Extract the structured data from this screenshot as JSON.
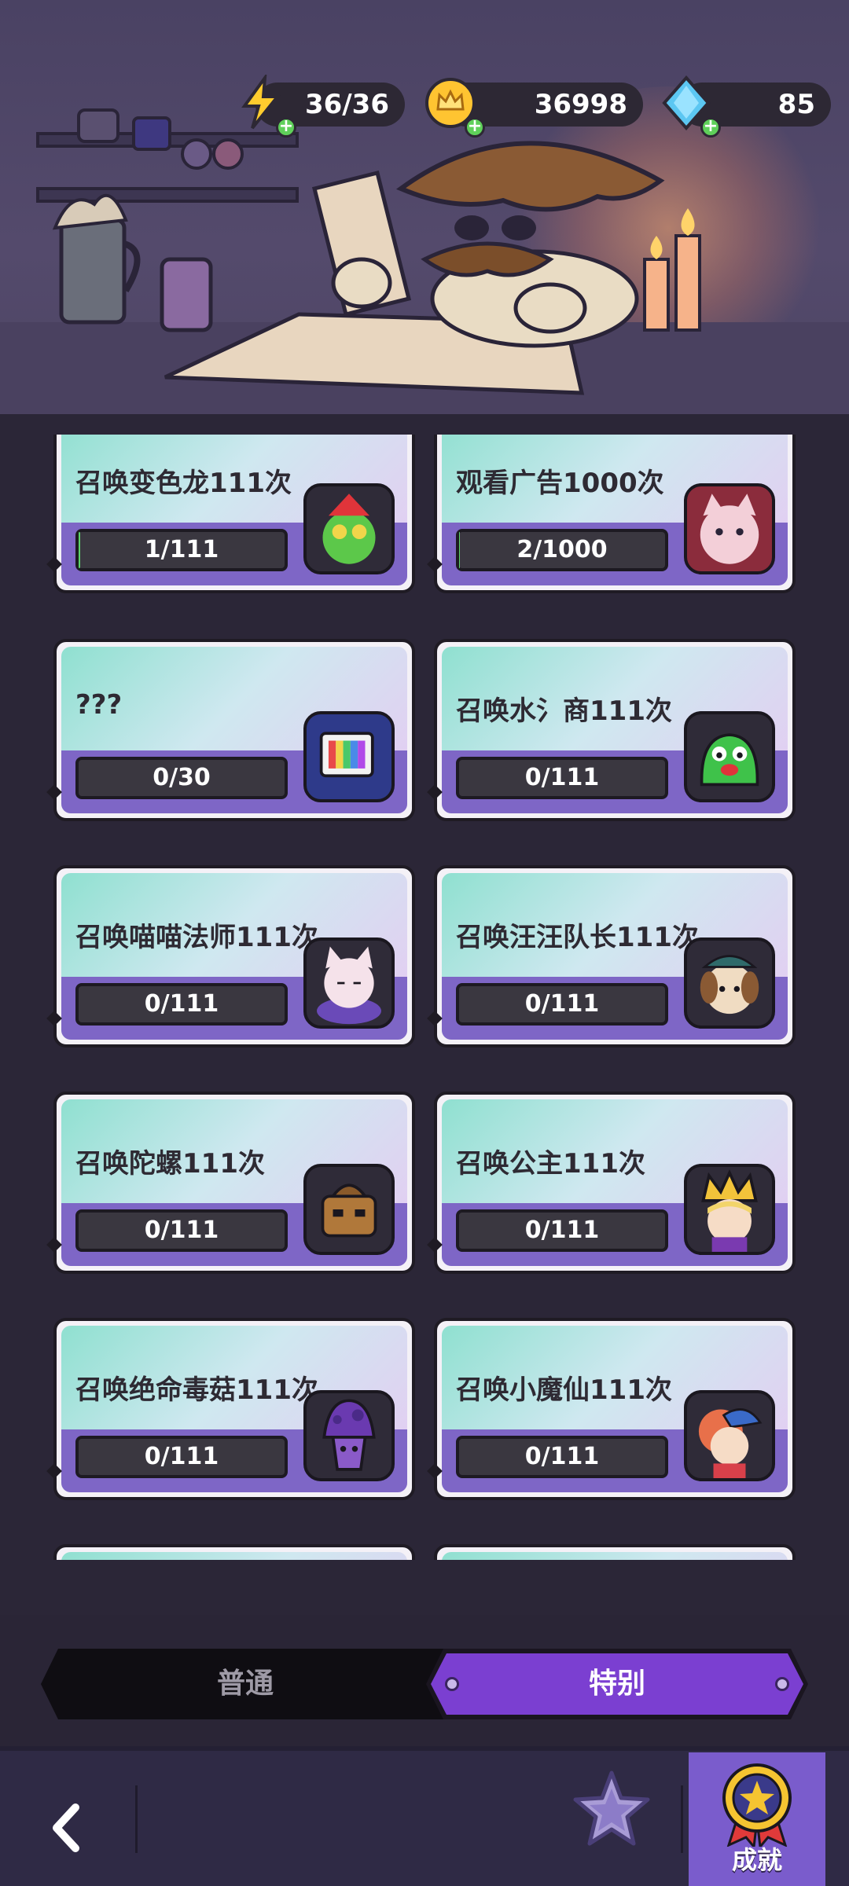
{
  "resources": {
    "energy": "36/36",
    "gold": "36998",
    "gems": "85"
  },
  "cards": [
    {
      "title": "召唤变色龙111次",
      "progress": "1/111",
      "fraction": 0.009,
      "portrait": "chameleon-portrait-icon"
    },
    {
      "title": "观看广告1000次",
      "progress": "2/1000",
      "fraction": 0.002,
      "portrait": "cat-portrait-icon"
    },
    {
      "title": "???",
      "progress": "0/30",
      "fraction": 0,
      "portrait": "tv-portrait-icon"
    },
    {
      "title": "召唤水氵商111次",
      "progress": "0/111",
      "fraction": 0,
      "portrait": "slime-portrait-icon"
    },
    {
      "title": "召唤喵喵法师111次",
      "progress": "0/111",
      "fraction": 0,
      "portrait": "cat-mage-portrait-icon"
    },
    {
      "title": "召唤汪汪队长111次",
      "progress": "0/111",
      "fraction": 0,
      "portrait": "dog-captain-portrait-icon"
    },
    {
      "title": "召唤陀螺111次",
      "progress": "0/111",
      "fraction": 0,
      "portrait": "spinning-top-portrait-icon"
    },
    {
      "title": "召唤公主111次",
      "progress": "0/111",
      "fraction": 0,
      "portrait": "princess-portrait-icon"
    },
    {
      "title": "召唤绝命毒菇111次",
      "progress": "0/111",
      "fraction": 0,
      "portrait": "poison-mushroom-portrait-icon"
    },
    {
      "title": "召唤小魔仙111次",
      "progress": "0/111",
      "fraction": 0,
      "portrait": "little-fairy-portrait-icon"
    },
    {
      "title": "",
      "progress": "",
      "fraction": 0,
      "portrait": ""
    },
    {
      "title": "",
      "progress": "",
      "fraction": 0,
      "portrait": ""
    }
  ],
  "tabs": {
    "normal": "普通",
    "special": "特别",
    "active": "special"
  },
  "bottom_nav": {
    "achievement_label": "成就"
  },
  "colors": {
    "accent_purple": "#7b3fd1",
    "progress_bar": "#3a3740"
  }
}
